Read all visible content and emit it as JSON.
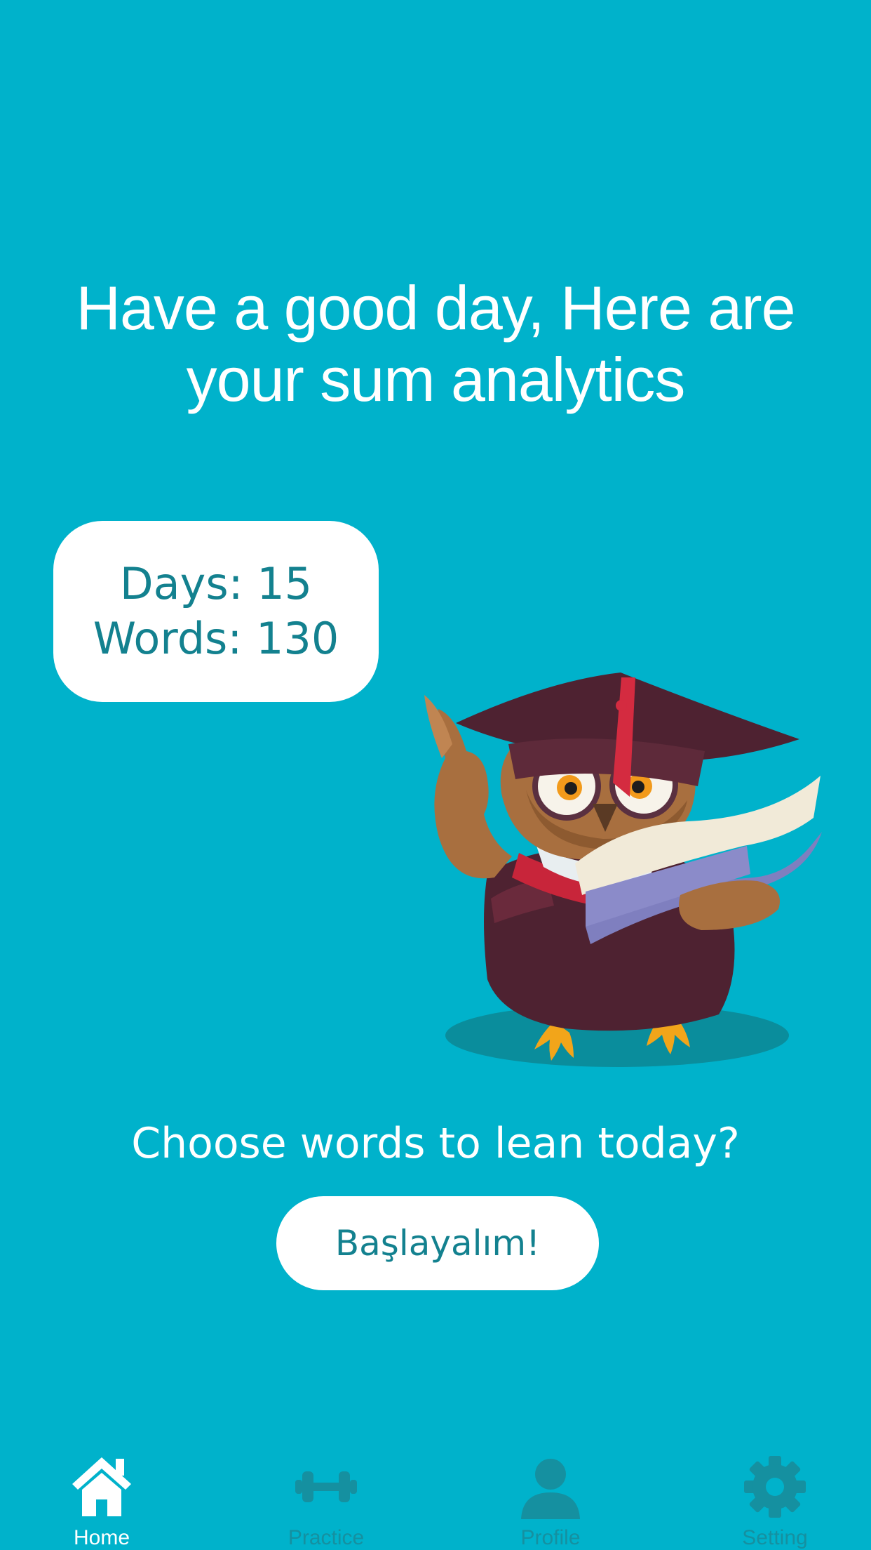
{
  "greeting": {
    "line1": "Have a good day, Here are",
    "line2": "your sum analytics"
  },
  "stats": {
    "days": "Days: 15",
    "words": "Words: 130"
  },
  "prompt": {
    "question": "Choose words to lean today?",
    "button_label": "Başlayalım!"
  },
  "tabbar": {
    "active_tab": "Home",
    "items": [
      {
        "label": "Home",
        "icon": "home-icon"
      },
      {
        "label": "Practice",
        "icon": "dumbbell-icon"
      },
      {
        "label": "Profile",
        "icon": "person-icon"
      },
      {
        "label": "Setting",
        "icon": "gear-icon"
      }
    ]
  },
  "colors": {
    "background": "#00b2cb",
    "accent_text": "#13818f",
    "inactive_tab": "#1590a0",
    "active_tab": "#ffffff"
  }
}
